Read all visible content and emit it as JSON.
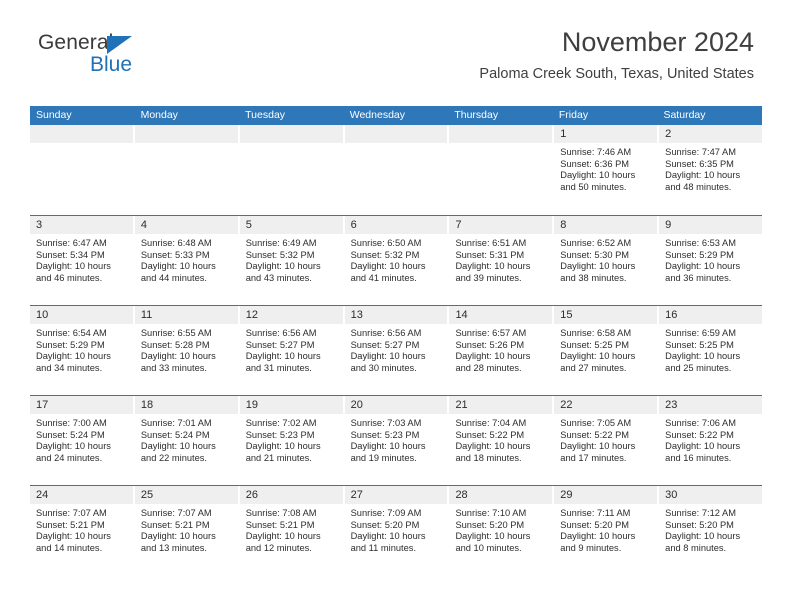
{
  "brand": {
    "name_part1": "General",
    "name_part2": "Blue",
    "triangle_color": "#1f72b8"
  },
  "header": {
    "month_title": "November 2024",
    "location": "Paloma Creek South, Texas, United States"
  },
  "theme": {
    "header_blue": "#2e77b8",
    "band_gray": "#efefef",
    "text": "#2d2d2d"
  },
  "weekdays": [
    "Sunday",
    "Monday",
    "Tuesday",
    "Wednesday",
    "Thursday",
    "Friday",
    "Saturday"
  ],
  "weeks": [
    [
      {
        "day": "",
        "sunrise": "",
        "sunset": "",
        "daylight": "",
        "empty": true
      },
      {
        "day": "",
        "sunrise": "",
        "sunset": "",
        "daylight": "",
        "empty": true
      },
      {
        "day": "",
        "sunrise": "",
        "sunset": "",
        "daylight": "",
        "empty": true
      },
      {
        "day": "",
        "sunrise": "",
        "sunset": "",
        "daylight": "",
        "empty": true
      },
      {
        "day": "",
        "sunrise": "",
        "sunset": "",
        "daylight": "",
        "empty": true
      },
      {
        "day": "1",
        "sunrise": "Sunrise: 7:46 AM",
        "sunset": "Sunset: 6:36 PM",
        "daylight": "Daylight: 10 hours and 50 minutes."
      },
      {
        "day": "2",
        "sunrise": "Sunrise: 7:47 AM",
        "sunset": "Sunset: 6:35 PM",
        "daylight": "Daylight: 10 hours and 48 minutes."
      }
    ],
    [
      {
        "day": "3",
        "sunrise": "Sunrise: 6:47 AM",
        "sunset": "Sunset: 5:34 PM",
        "daylight": "Daylight: 10 hours and 46 minutes."
      },
      {
        "day": "4",
        "sunrise": "Sunrise: 6:48 AM",
        "sunset": "Sunset: 5:33 PM",
        "daylight": "Daylight: 10 hours and 44 minutes."
      },
      {
        "day": "5",
        "sunrise": "Sunrise: 6:49 AM",
        "sunset": "Sunset: 5:32 PM",
        "daylight": "Daylight: 10 hours and 43 minutes."
      },
      {
        "day": "6",
        "sunrise": "Sunrise: 6:50 AM",
        "sunset": "Sunset: 5:32 PM",
        "daylight": "Daylight: 10 hours and 41 minutes."
      },
      {
        "day": "7",
        "sunrise": "Sunrise: 6:51 AM",
        "sunset": "Sunset: 5:31 PM",
        "daylight": "Daylight: 10 hours and 39 minutes."
      },
      {
        "day": "8",
        "sunrise": "Sunrise: 6:52 AM",
        "sunset": "Sunset: 5:30 PM",
        "daylight": "Daylight: 10 hours and 38 minutes."
      },
      {
        "day": "9",
        "sunrise": "Sunrise: 6:53 AM",
        "sunset": "Sunset: 5:29 PM",
        "daylight": "Daylight: 10 hours and 36 minutes."
      }
    ],
    [
      {
        "day": "10",
        "sunrise": "Sunrise: 6:54 AM",
        "sunset": "Sunset: 5:29 PM",
        "daylight": "Daylight: 10 hours and 34 minutes."
      },
      {
        "day": "11",
        "sunrise": "Sunrise: 6:55 AM",
        "sunset": "Sunset: 5:28 PM",
        "daylight": "Daylight: 10 hours and 33 minutes."
      },
      {
        "day": "12",
        "sunrise": "Sunrise: 6:56 AM",
        "sunset": "Sunset: 5:27 PM",
        "daylight": "Daylight: 10 hours and 31 minutes."
      },
      {
        "day": "13",
        "sunrise": "Sunrise: 6:56 AM",
        "sunset": "Sunset: 5:27 PM",
        "daylight": "Daylight: 10 hours and 30 minutes."
      },
      {
        "day": "14",
        "sunrise": "Sunrise: 6:57 AM",
        "sunset": "Sunset: 5:26 PM",
        "daylight": "Daylight: 10 hours and 28 minutes."
      },
      {
        "day": "15",
        "sunrise": "Sunrise: 6:58 AM",
        "sunset": "Sunset: 5:25 PM",
        "daylight": "Daylight: 10 hours and 27 minutes."
      },
      {
        "day": "16",
        "sunrise": "Sunrise: 6:59 AM",
        "sunset": "Sunset: 5:25 PM",
        "daylight": "Daylight: 10 hours and 25 minutes."
      }
    ],
    [
      {
        "day": "17",
        "sunrise": "Sunrise: 7:00 AM",
        "sunset": "Sunset: 5:24 PM",
        "daylight": "Daylight: 10 hours and 24 minutes."
      },
      {
        "day": "18",
        "sunrise": "Sunrise: 7:01 AM",
        "sunset": "Sunset: 5:24 PM",
        "daylight": "Daylight: 10 hours and 22 minutes."
      },
      {
        "day": "19",
        "sunrise": "Sunrise: 7:02 AM",
        "sunset": "Sunset: 5:23 PM",
        "daylight": "Daylight: 10 hours and 21 minutes."
      },
      {
        "day": "20",
        "sunrise": "Sunrise: 7:03 AM",
        "sunset": "Sunset: 5:23 PM",
        "daylight": "Daylight: 10 hours and 19 minutes."
      },
      {
        "day": "21",
        "sunrise": "Sunrise: 7:04 AM",
        "sunset": "Sunset: 5:22 PM",
        "daylight": "Daylight: 10 hours and 18 minutes."
      },
      {
        "day": "22",
        "sunrise": "Sunrise: 7:05 AM",
        "sunset": "Sunset: 5:22 PM",
        "daylight": "Daylight: 10 hours and 17 minutes."
      },
      {
        "day": "23",
        "sunrise": "Sunrise: 7:06 AM",
        "sunset": "Sunset: 5:22 PM",
        "daylight": "Daylight: 10 hours and 16 minutes."
      }
    ],
    [
      {
        "day": "24",
        "sunrise": "Sunrise: 7:07 AM",
        "sunset": "Sunset: 5:21 PM",
        "daylight": "Daylight: 10 hours and 14 minutes."
      },
      {
        "day": "25",
        "sunrise": "Sunrise: 7:07 AM",
        "sunset": "Sunset: 5:21 PM",
        "daylight": "Daylight: 10 hours and 13 minutes."
      },
      {
        "day": "26",
        "sunrise": "Sunrise: 7:08 AM",
        "sunset": "Sunset: 5:21 PM",
        "daylight": "Daylight: 10 hours and 12 minutes."
      },
      {
        "day": "27",
        "sunrise": "Sunrise: 7:09 AM",
        "sunset": "Sunset: 5:20 PM",
        "daylight": "Daylight: 10 hours and 11 minutes."
      },
      {
        "day": "28",
        "sunrise": "Sunrise: 7:10 AM",
        "sunset": "Sunset: 5:20 PM",
        "daylight": "Daylight: 10 hours and 10 minutes."
      },
      {
        "day": "29",
        "sunrise": "Sunrise: 7:11 AM",
        "sunset": "Sunset: 5:20 PM",
        "daylight": "Daylight: 10 hours and 9 minutes."
      },
      {
        "day": "30",
        "sunrise": "Sunrise: 7:12 AM",
        "sunset": "Sunset: 5:20 PM",
        "daylight": "Daylight: 10 hours and 8 minutes."
      }
    ]
  ]
}
